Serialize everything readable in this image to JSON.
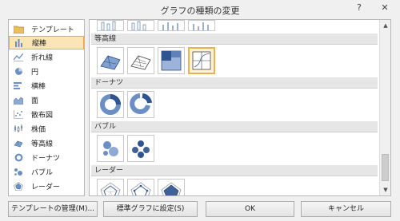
{
  "window": {
    "title": "グラフの種類の変更",
    "help_label": "?",
    "close_label": "✕"
  },
  "categories": [
    {
      "label": "テンプレート",
      "icon": "folder-icon"
    },
    {
      "label": "縦棒",
      "icon": "column-chart-icon",
      "selected": true
    },
    {
      "label": "折れ線",
      "icon": "line-chart-icon"
    },
    {
      "label": "円",
      "icon": "pie-chart-icon"
    },
    {
      "label": "横棒",
      "icon": "bar-chart-icon"
    },
    {
      "label": "面",
      "icon": "area-chart-icon"
    },
    {
      "label": "散布図",
      "icon": "scatter-chart-icon"
    },
    {
      "label": "株価",
      "icon": "stock-chart-icon"
    },
    {
      "label": "等高線",
      "icon": "surface-chart-icon"
    },
    {
      "label": "ドーナツ",
      "icon": "doughnut-chart-icon"
    },
    {
      "label": "バブル",
      "icon": "bubble-chart-icon"
    },
    {
      "label": "レーダー",
      "icon": "radar-chart-icon"
    }
  ],
  "gallery": {
    "sections": [
      {
        "title": "等高線",
        "thumbs": [
          "3d-surface-icon",
          "wireframe-surface-icon",
          "contour-icon",
          "wireframe-contour-icon"
        ],
        "selected_index": 3
      },
      {
        "title": "ドーナツ",
        "thumbs": [
          "doughnut-icon",
          "exploded-doughnut-icon"
        ]
      },
      {
        "title": "バブル",
        "thumbs": [
          "bubble-icon",
          "3d-bubble-icon"
        ]
      },
      {
        "title": "レーダー",
        "thumbs": [
          "radar-icon",
          "radar-markers-icon",
          "filled-radar-icon"
        ]
      }
    ]
  },
  "buttons": {
    "manage_templates": "テンプレートの管理(M)...",
    "set_default": "標準グラフに設定(S)",
    "ok": "OK",
    "cancel": "キャンセル"
  }
}
